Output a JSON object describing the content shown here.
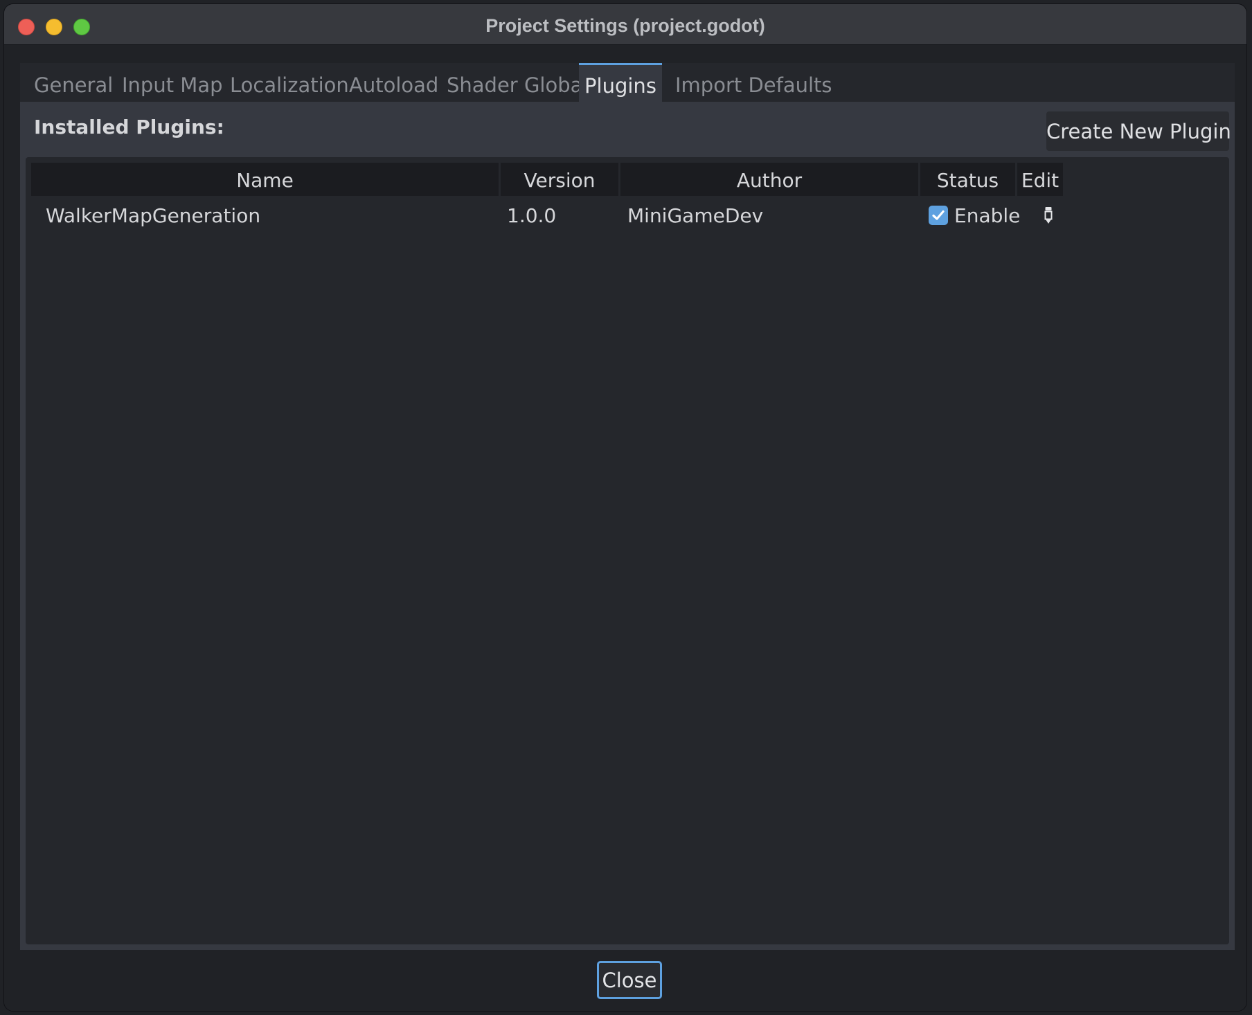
{
  "window": {
    "title": "Project Settings (project.godot)"
  },
  "tabs": [
    {
      "label": "General"
    },
    {
      "label": "Input Map"
    },
    {
      "label": "Localization"
    },
    {
      "label": "Autoload"
    },
    {
      "label": "Shader Globals"
    },
    {
      "label": "Plugins"
    },
    {
      "label": "Import Defaults"
    }
  ],
  "active_tab": "Plugins",
  "plugins_panel": {
    "installed_label": "Installed Plugins:",
    "create_button_label": "Create New Plugin",
    "columns": {
      "name": "Name",
      "version": "Version",
      "author": "Author",
      "status": "Status",
      "edit": "Edit"
    },
    "rows": [
      {
        "name": "WalkerMapGeneration",
        "version": "1.0.0",
        "author": "MiniGameDev",
        "status_label": "Enable",
        "enabled": true
      }
    ]
  },
  "footer": {
    "close_label": "Close"
  },
  "colors": {
    "accent": "#5ea1e0",
    "traffic_close": "#ee5f57",
    "traffic_minimize": "#f5bd2f",
    "traffic_maximize": "#5fc843"
  },
  "icons": {
    "edit": "pencil-icon",
    "checkbox": "checkmark-icon"
  }
}
